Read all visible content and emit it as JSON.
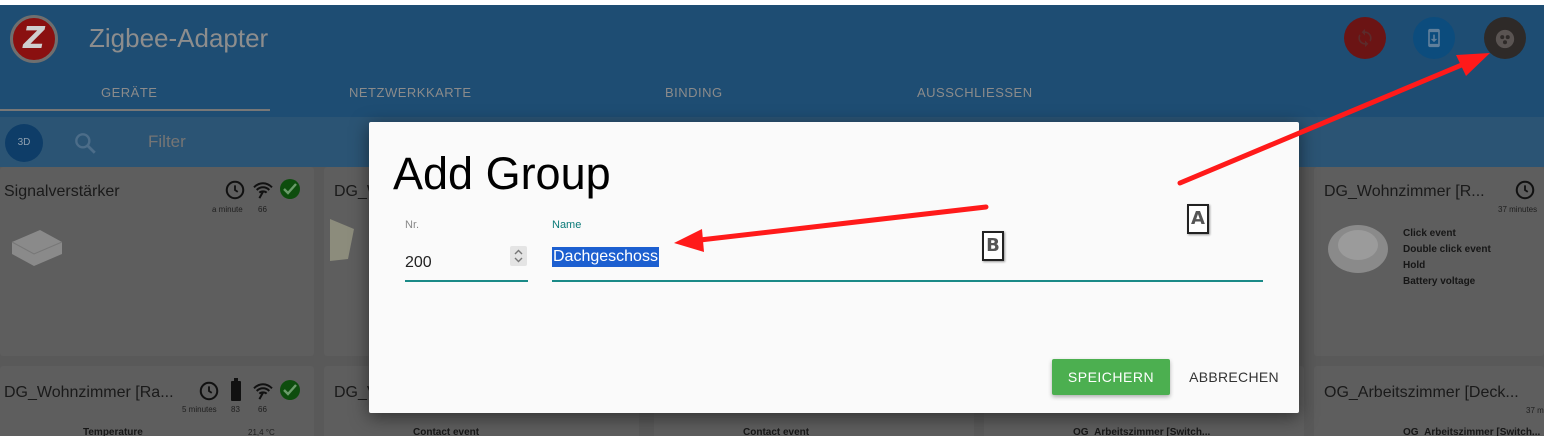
{
  "app": {
    "title": "Zigbee-Adapter",
    "logo_letter": "Z",
    "tabs": [
      "GERÄTE",
      "NETZWERKKARTE",
      "BINDING",
      "AUSSCHLIESSEN"
    ],
    "active_tab": "GERÄTE",
    "toolbar_3d_label": "3D",
    "filter_placeholder": "Filter",
    "icons": {
      "refresh": "refresh-icon",
      "phone": "phone-download-icon",
      "group": "add-group-icon"
    },
    "colors": {
      "appbar": "#2f6e9c",
      "refresh_btn": "#c62828",
      "phone_btn": "#1565c0",
      "group_btn": "#4e4542",
      "ok": "#2e7d32"
    }
  },
  "cards": [
    {
      "title": "Signalverstärker",
      "time": "a minute",
      "link": "66"
    },
    {
      "title": "DG_W"
    },
    {
      "title": "DG_Wohnzimmer [R...",
      "time": "37 minutes",
      "events": [
        "Click event",
        "Double click event",
        "Hold",
        "Battery voltage"
      ]
    },
    {
      "title": "DG_Wohnzimmer [Ra...",
      "time": "5 minutes",
      "battery": "83",
      "link": "66",
      "events": [
        "Temperature"
      ],
      "value": "21,4 °C"
    },
    {
      "title": "DG_V",
      "events": [
        "Contact event"
      ]
    },
    {
      "events": [
        "Contact event"
      ]
    },
    {
      "events": [
        "OG_Arbeitszimmer [Switch..."
      ]
    },
    {
      "title": "OG_Arbeitszimmer [Deck...",
      "time": "37 m",
      "events": [
        "OG_Arbeitszimmer [Switch..."
      ]
    }
  ],
  "dialog": {
    "title": "Add Group",
    "nr_label": "Nr.",
    "nr_value": "200",
    "name_label": "Name",
    "name_value": "Dachgeschoss",
    "save_label": "SPEICHERN",
    "cancel_label": "ABBRECHEN",
    "save_color": "#4caf50"
  },
  "annotations": {
    "label_a": "A",
    "label_b": "B",
    "arrow_color": "#ff1a1a"
  }
}
